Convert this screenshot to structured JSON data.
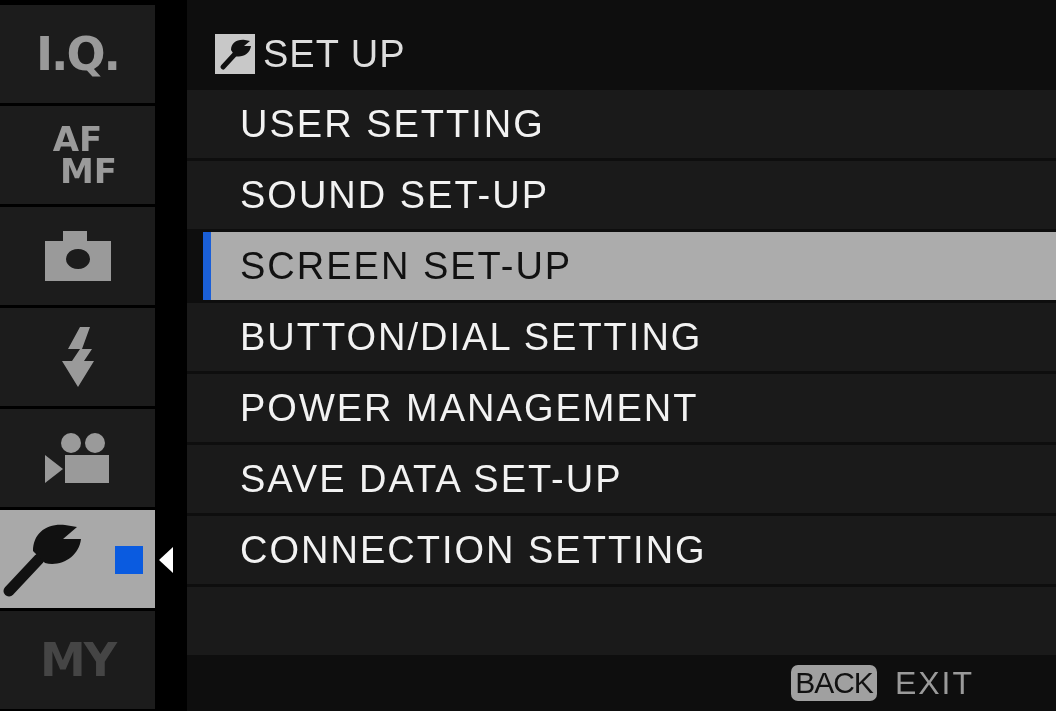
{
  "sidebar": {
    "tabs": [
      {
        "kind": "text",
        "label": "I.Q.",
        "selected": false,
        "disabled": false
      },
      {
        "kind": "stacked",
        "lines": [
          "AF",
          "MF"
        ],
        "selected": false,
        "disabled": false
      },
      {
        "kind": "camera",
        "selected": false,
        "disabled": false
      },
      {
        "kind": "flash",
        "selected": false,
        "disabled": false
      },
      {
        "kind": "movie",
        "selected": false,
        "disabled": false
      },
      {
        "kind": "wrench",
        "selected": true,
        "disabled": false
      },
      {
        "kind": "text",
        "label": "MY",
        "selected": false,
        "disabled": true
      }
    ]
  },
  "header": {
    "title": "SET UP"
  },
  "menu": {
    "items": [
      {
        "label": "USER SETTING",
        "selected": false
      },
      {
        "label": "SOUND SET-UP",
        "selected": false
      },
      {
        "label": "SCREEN SET-UP",
        "selected": true
      },
      {
        "label": "BUTTON/DIAL SETTING",
        "selected": false
      },
      {
        "label": "POWER MANAGEMENT",
        "selected": false
      },
      {
        "label": "SAVE DATA SET-UP",
        "selected": false
      },
      {
        "label": "CONNECTION SETTING",
        "selected": false
      }
    ]
  },
  "footer": {
    "key": "BACK",
    "action": "EXIT"
  }
}
